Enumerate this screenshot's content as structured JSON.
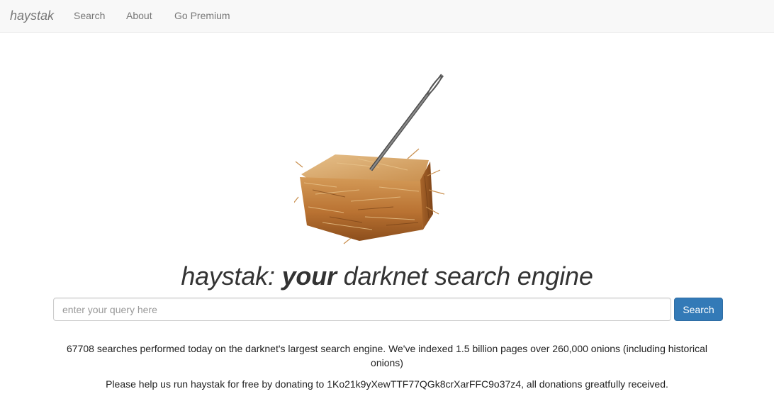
{
  "navbar": {
    "brand": "haystak",
    "links": [
      "Search",
      "About",
      "Go Premium"
    ]
  },
  "hero": {
    "image_description": "haystack-with-needle"
  },
  "headline": {
    "part1": "haystak:",
    "part2": "your",
    "part3": "darknet search engine"
  },
  "search": {
    "placeholder": "enter your query here",
    "value": "",
    "button_label": "Search"
  },
  "stats": {
    "text": "67708 searches performed today on the darknet's largest search engine. We've indexed 1.5 billion pages over 260,000 onions (including historical onions)"
  },
  "donate": {
    "text": "Please help us run haystak for free by donating to 1Ko21k9yXewTTF77QGk8crXarFFC9o37z4, all donations greatfully received."
  },
  "colors": {
    "primary": "#337ab7",
    "navbar_bg": "#f8f8f8",
    "nav_text": "#777777",
    "text": "#333333"
  }
}
